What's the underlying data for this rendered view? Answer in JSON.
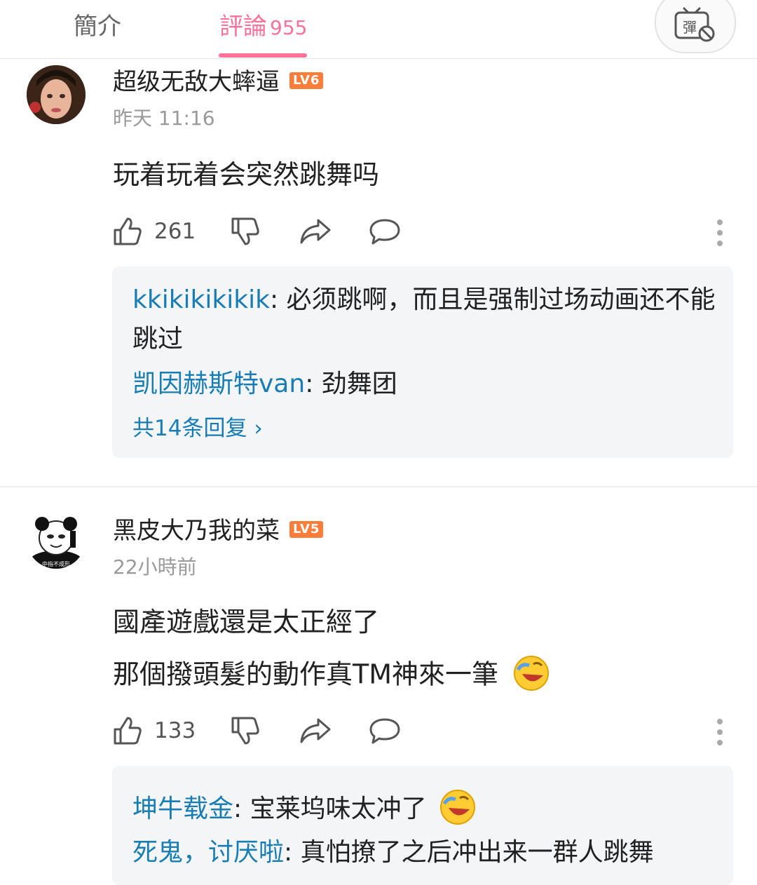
{
  "tabs": {
    "intro": "簡介",
    "comments": "評論",
    "comments_count": "955"
  },
  "danmaku_icon": "danmaku-off-icon",
  "comments": [
    {
      "username": "超级无敌大蟀逼",
      "level": "LV6",
      "time": "昨天 11:16",
      "lines": [
        "玩着玩着会突然跳舞吗"
      ],
      "likes": "261",
      "replies": [
        {
          "name": "kkikikikikik",
          "text": "必须跳啊，而且是强制过场动画还不能跳过"
        },
        {
          "name": "凯因赫斯特van",
          "text": "劲舞团"
        }
      ],
      "more_replies": "共14条回复"
    },
    {
      "username": "黑皮大乃我的菜",
      "level": "LV5",
      "time": "22小時前",
      "lines": [
        "國產遊戲還是太正經了",
        "那個撥頭髮的動作真TM神來一筆"
      ],
      "likes": "133",
      "avatar_caption": "中指不成形",
      "replies": [
        {
          "name": "坤牛载金",
          "text": "宝莱坞味太冲了"
        },
        {
          "name": "死鬼，讨厌啦",
          "text": "真怕撩了之后冲出来一群人跳舞"
        }
      ]
    }
  ],
  "colors": {
    "accent": "#fb7299",
    "reply_name": "#177db4",
    "level": "#fb7d3a"
  }
}
